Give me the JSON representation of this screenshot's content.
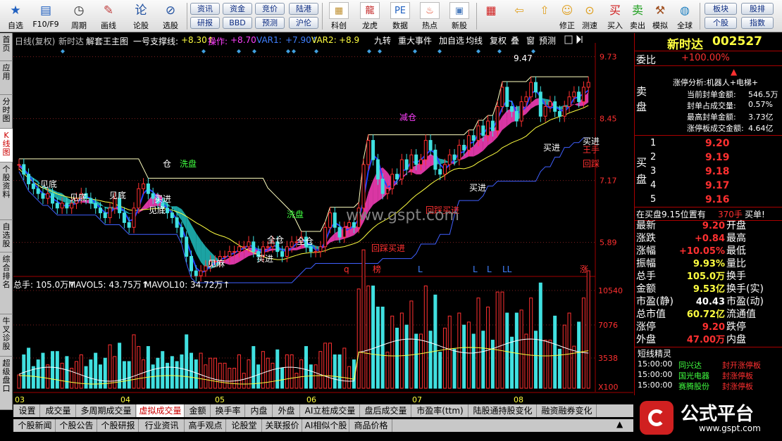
{
  "toolbar": {
    "buttons": [
      {
        "label": "自选",
        "icon": "star-icon"
      },
      {
        "label": "F10/F9",
        "icon": "book-icon"
      },
      {
        "label": "周期",
        "icon": "clock-icon"
      },
      {
        "label": "画线",
        "icon": "pencil-icon"
      },
      {
        "label": "论股",
        "icon": "discuss-icon"
      },
      {
        "label": "选股",
        "icon": "chart-search-icon"
      }
    ],
    "pills": [
      "资讯",
      "资金",
      "竞价",
      "陆港",
      "研报",
      "BBD",
      "预测",
      "沪伦"
    ],
    "buttons2": [
      {
        "label": "科创",
        "icon": "kechuang-icon"
      },
      {
        "label": "龙虎",
        "icon": "dragon-tiger-icon"
      },
      {
        "label": "数据",
        "icon": "pe-data-icon"
      },
      {
        "label": "热点",
        "icon": "hot-icon"
      },
      {
        "label": "新股",
        "icon": "ipo-icon"
      }
    ],
    "buttons3": [
      {
        "label": "",
        "icon": "color-grid-icon"
      },
      {
        "label": "",
        "icon": "back-arrow-icon"
      },
      {
        "label": "",
        "icon": "up-arrow-icon"
      },
      {
        "label": "修正",
        "icon": "fix-icon"
      },
      {
        "label": "测速",
        "icon": "speed-icon"
      },
      {
        "label": "买入",
        "icon": "buy-icon"
      },
      {
        "label": "卖出",
        "icon": "sell-icon"
      },
      {
        "label": "模拟",
        "icon": "hammer-icon"
      },
      {
        "label": "全球",
        "icon": "globe-icon"
      }
    ],
    "buy_glyph": "买",
    "sell_glyph": "卖",
    "pills2": [
      "板块",
      "股排",
      "个股",
      "指数"
    ]
  },
  "left_tabs": [
    "首页",
    "应用",
    "分时图",
    "K线图",
    "个股资料",
    "自选股",
    "综合排名",
    "牛叉诊股",
    "超级盘口"
  ],
  "chart_header": {
    "period": "日线(复权)",
    "name": "新时达",
    "indicator": "解套王主图",
    "support_label": "一号支撑线:",
    "support_value": "+8.30↑",
    "op_label": "操作:",
    "op_value": "+8.70",
    "var1_label": "VAR1:",
    "var1_value": "+7.90↑",
    "var2_label": "VAR2:",
    "var2_value": "+8.9"
  },
  "chart_tools": [
    "九转",
    "重大事件",
    "加自选",
    "均线",
    "复权",
    "叠",
    "窗",
    "预测"
  ],
  "price_axis": [
    "9.73",
    "8.45",
    "7.17",
    "5.89"
  ],
  "volume_axis": [
    "10540",
    "7076",
    "3538",
    "X100"
  ],
  "x_labels": [
    "03",
    "04",
    "05",
    "06",
    "07",
    "08"
  ],
  "annotations": {
    "high": "9.47",
    "jiancang": "减仓",
    "xipan1": "洗盘",
    "xipan2": "洗盘",
    "jiandi1": "见底",
    "jiandi2": "见底",
    "jiandi3": "见底",
    "jiandi4": "见底",
    "jianmie": "见麻",
    "maijin1": "买进",
    "maijin2": "买进",
    "maijin3": "买进",
    "maijin4": "买进",
    "maijin5": "买进",
    "quancang1": "全仓",
    "quancang2": "全仓",
    "huicai1": "回踩买进",
    "huicai2": "回踩买进",
    "huicai3": "回踩",
    "wangshou": "王手",
    "huicang": "仓",
    "m_q": "q",
    "m_bang": "榜",
    "m_L1": "L",
    "m_L2": "L",
    "m_L3": "L",
    "m_LL": "LL",
    "m_zhang": "涨"
  },
  "volume_header": {
    "total": "总手: 105.0万↑",
    "mavol5": "MAVOL5: 43.75万↑",
    "mavol10": "MAVOL10: 34.72万↑"
  },
  "watermark": "www.gspt.com",
  "stock": {
    "name": "新时达",
    "code": "002527"
  },
  "weibi": {
    "label": "委比",
    "value": "+100.00%"
  },
  "limit_info": {
    "line1": "涨停分析:机器人+电梯+",
    "rows": [
      {
        "label": "当前封单金额:",
        "value": "546.5万"
      },
      {
        "label": "封单占成交量:",
        "value": "0.57%"
      },
      {
        "label": "最高封单金额:",
        "value": "3.73亿"
      },
      {
        "label": "涨停板成交金额:",
        "value": "4.64亿"
      }
    ]
  },
  "sell_label": "卖盘",
  "buy_label": "买盘",
  "buy_levels": [
    {
      "level": "1",
      "price": "9.20"
    },
    {
      "level": "2",
      "price": "9.19"
    },
    {
      "level": "3",
      "price": "9.18"
    },
    {
      "level": "4",
      "price": "9.17"
    },
    {
      "level": "5",
      "price": "9.16"
    }
  ],
  "inbuy": {
    "text": "在买盘9.15位置有",
    "qty": "370手",
    "action": "买单!"
  },
  "quote_rows": [
    {
      "l": "最新",
      "v": "9.20",
      "r": "开盘",
      "vc": "#ff3030"
    },
    {
      "l": "涨跌",
      "v": "+0.84",
      "r": "最高",
      "vc": "#ff3030"
    },
    {
      "l": "涨幅",
      "v": "+10.05%",
      "r": "最低",
      "vc": "#ff3030"
    },
    {
      "l": "振幅",
      "v": "9.93%",
      "r": "量比",
      "vc": "#ffff40"
    },
    {
      "l": "总手",
      "v": "105.0万",
      "r": "换手",
      "vc": "#ffff40"
    },
    {
      "l": "金额",
      "v": "9.53亿",
      "r": "换手(实)",
      "vc": "#ffff40"
    },
    {
      "l": "市盈(静)",
      "v": "40.43",
      "r": "市盈(动)",
      "vc": "#ffffff"
    },
    {
      "l": "总市值",
      "v": "60.72亿",
      "r": "流通值",
      "vc": "#ffff40"
    },
    {
      "l": "涨停",
      "v": "9.20",
      "r": "跌停",
      "vc": "#ff3030"
    },
    {
      "l": "外盘",
      "v": "47.00万",
      "r": "内盘",
      "vc": "#ff3030"
    }
  ],
  "short_spirit": {
    "title": "短线精灵",
    "rows": [
      {
        "time": "15:00:00",
        "name": "同兴达",
        "event": "封开涨停板"
      },
      {
        "time": "15:00:00",
        "name": "国光电器",
        "event": "封涨停板"
      },
      {
        "time": "15:00:00",
        "name": "赛腾股份",
        "event": "封涨停板"
      }
    ]
  },
  "bottom_tabs1": [
    "设置",
    "成交量",
    "多周期成交量",
    "虚拟成交量",
    "金额",
    "换手率",
    "内盘",
    "外盘",
    "AI立桩成交量",
    "盘后成交量",
    "市盈率(ttm)",
    "陆股通持股变化",
    "融资融券变化"
  ],
  "bottom_tabs2": [
    "个股新闻",
    "个股公告",
    "个股研报",
    "行业资讯",
    "高手观点",
    "论股堂",
    "关联报价",
    "AI相似个股",
    "商品价格"
  ],
  "logo": {
    "text": "公式平台",
    "url": "www.gspt.com"
  },
  "chart_data": {
    "type": "candlestick",
    "x_months": [
      "03",
      "04",
      "05",
      "06",
      "07",
      "08"
    ],
    "price_ylim": [
      5.2,
      9.9
    ],
    "price_ticks": [
      9.73,
      8.45,
      7.17,
      5.89
    ],
    "high": 9.47,
    "last": 9.2,
    "volume_ticks_x100": [
      10540,
      7076,
      3538
    ],
    "close": [
      7.5,
      7.3,
      7.1,
      7.0,
      6.9,
      6.8,
      6.9,
      6.7,
      6.6,
      6.7,
      6.6,
      6.7,
      6.8,
      6.9,
      6.8,
      6.7,
      6.6,
      6.5,
      6.4,
      6.6,
      6.8,
      6.5,
      6.3,
      6.2,
      6.6,
      7.0,
      7.1,
      6.9,
      6.8,
      6.7,
      6.6,
      6.5,
      6.4,
      6.2,
      6.0,
      5.6,
      5.3,
      5.2,
      5.3,
      5.4,
      5.5,
      5.5,
      5.6,
      5.6,
      5.7,
      5.7,
      5.8,
      5.8,
      5.9,
      5.7,
      5.6,
      5.8,
      5.8,
      5.9,
      5.7,
      5.6,
      5.8,
      5.9,
      5.9,
      6.0,
      5.8,
      5.7,
      5.7,
      5.8,
      6.2,
      6.5,
      6.2,
      6.0,
      6.2,
      6.3,
      6.2,
      6.6,
      7.5,
      8.0,
      7.6,
      7.2,
      6.9,
      7.0,
      7.3,
      7.2,
      7.6,
      7.4,
      7.7,
      7.5,
      7.6,
      8.0,
      7.8,
      7.4,
      7.3,
      7.5,
      7.7,
      7.6,
      7.9,
      7.8,
      8.1,
      8.0,
      8.3,
      8.1,
      8.4,
      8.2,
      8.7,
      9.1,
      8.7,
      8.6,
      8.4,
      8.8,
      8.9,
      9.2,
      9.0,
      8.5,
      8.7,
      8.8,
      8.6,
      8.5,
      8.7,
      8.9,
      9.0,
      8.8,
      9.1,
      9.2
    ]
  }
}
